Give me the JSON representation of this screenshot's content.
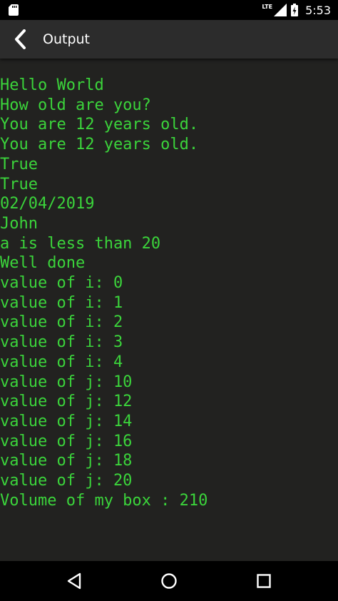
{
  "status_bar": {
    "network": "LTE",
    "time": "5:53",
    "icons": [
      "sd-card-icon",
      "signal-icon",
      "battery-icon"
    ]
  },
  "app_bar": {
    "title": "Output",
    "back_icon": "back-arrow-icon"
  },
  "console": {
    "text_color": "#3bd43b",
    "background_color": "#222220",
    "lines": [
      "Hello World",
      "How old are you?",
      "You are 12 years old.",
      "You are 12 years old.",
      "True",
      "True",
      "02/04/2019",
      "John",
      "a is less than 20",
      "Well done",
      "value of i: 0",
      "value of i: 1",
      "value of i: 2",
      "value of i: 3",
      "value of i: 4",
      "value of j: 10",
      "value of j: 12",
      "value of j: 14",
      "value of j: 16",
      "value of j: 18",
      "value of j: 20",
      "Volume of my box : 210"
    ]
  },
  "nav_bar": {
    "icons": [
      "back-triangle-icon",
      "home-circle-icon",
      "recents-square-icon"
    ]
  }
}
